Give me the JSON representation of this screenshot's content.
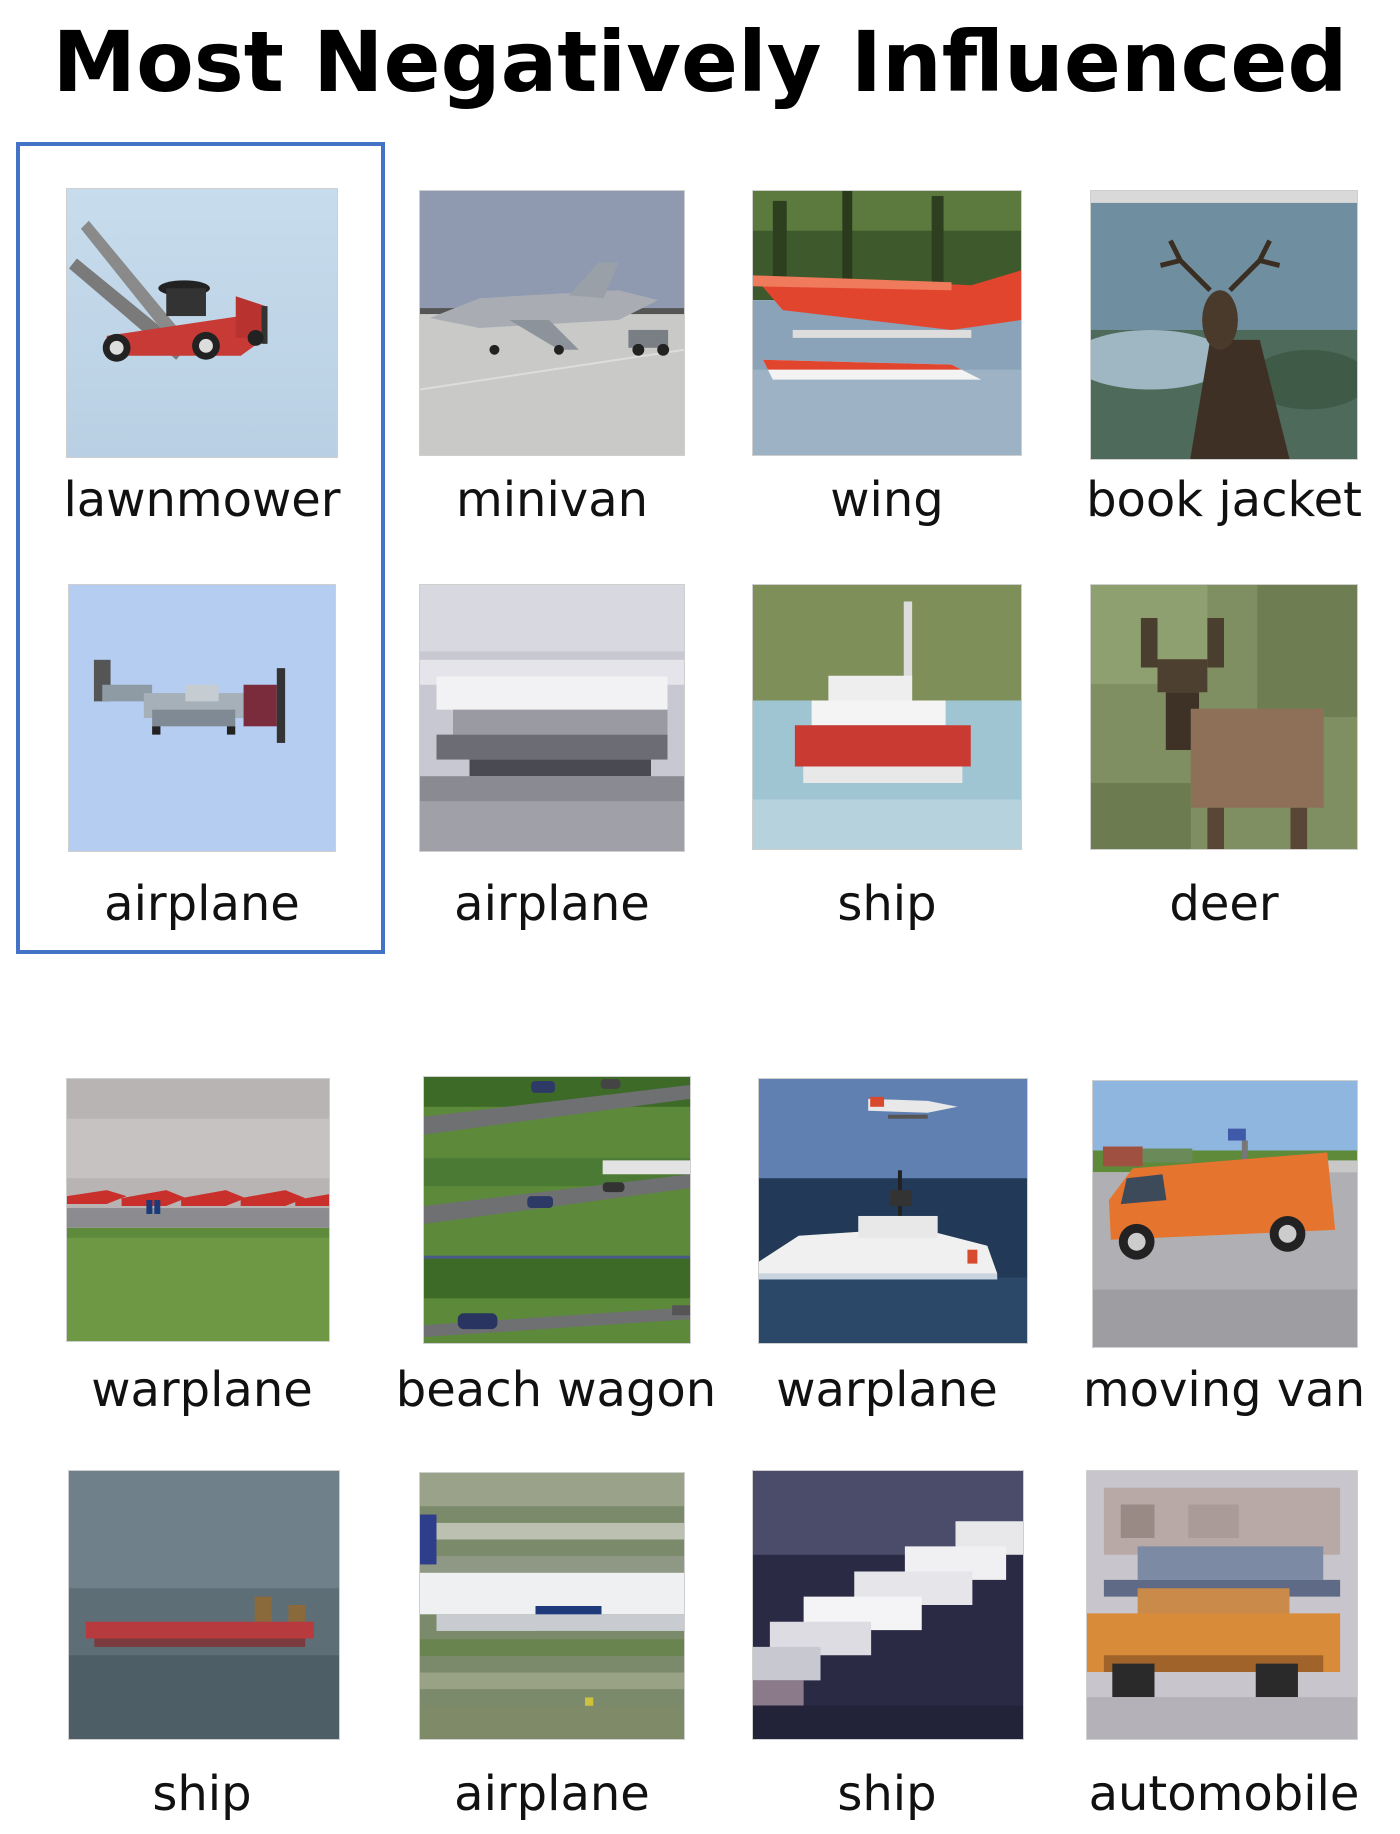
{
  "title": "Most Negatively Influenced",
  "highlight_color": "#4472c4",
  "grid": [
    {
      "label": "lawnmower",
      "icon": "lawnmower-photo"
    },
    {
      "label": "minivan",
      "icon": "jet-on-runway-photo"
    },
    {
      "label": "wing",
      "icon": "seaplane-photo"
    },
    {
      "label": "book jacket",
      "icon": "deer-book-cover-photo"
    },
    {
      "label": "airplane",
      "icon": "propeller-plane-lowres"
    },
    {
      "label": "airplane",
      "icon": "jet-lowres"
    },
    {
      "label": "ship",
      "icon": "boat-lowres"
    },
    {
      "label": "deer",
      "icon": "deer-lowres"
    },
    {
      "label": "warplane",
      "icon": "red-jets-lineup-photo"
    },
    {
      "label": "beach wagon",
      "icon": "cars-on-road-photo"
    },
    {
      "label": "warplane",
      "icon": "coast-guard-ship-photo"
    },
    {
      "label": "moving van",
      "icon": "orange-van-photo"
    },
    {
      "label": "ship",
      "icon": "ship-on-sea-lowres"
    },
    {
      "label": "airplane",
      "icon": "airliner-lowres"
    },
    {
      "label": "ship",
      "icon": "ship-dark-lowres"
    },
    {
      "label": "automobile",
      "icon": "orange-car-lowres"
    }
  ]
}
